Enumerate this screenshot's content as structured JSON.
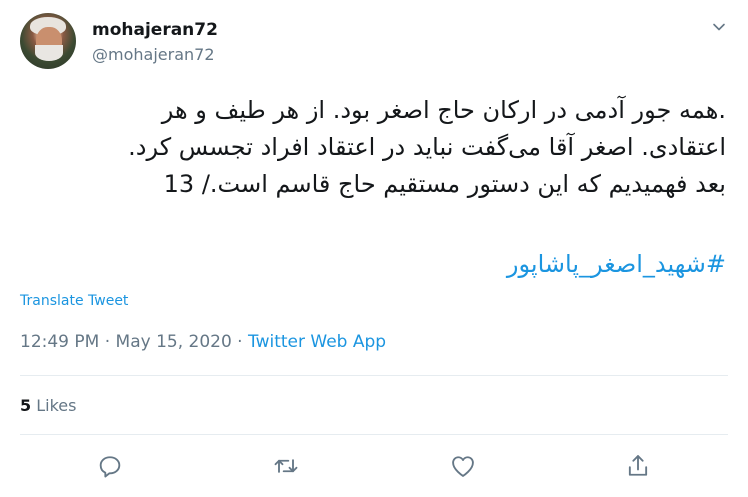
{
  "user": {
    "name": "mohajeran72",
    "handle": "@mohajeran72"
  },
  "tweet": {
    "lines": [
      ".همه جور آدمی در ارکان حاج اصغر بود. از هر طیف و هر",
      "اعتقادی. اصغر آقا می‌گفت نباید در اعتقاد افراد تجسس کرد.",
      "بعد فهمیدیم که این دستور مستقیم حاج قاسم است./ 13"
    ],
    "hashtag": "#شهید_اصغر_پاشاپور"
  },
  "translate_label": "Translate Tweet",
  "meta": {
    "time": "12:49 PM · May 15, 2020 · ",
    "source": "Twitter Web App"
  },
  "stats": {
    "likes_count": "5",
    "likes_label": "Likes"
  },
  "icons": {
    "menu": "chevron-down-icon",
    "reply": "reply-icon",
    "retweet": "retweet-icon",
    "like": "heart-icon",
    "share": "share-icon"
  },
  "colors": {
    "link": "#1b95e0",
    "secondary": "#657786",
    "text": "#14171a",
    "divider": "#e6ecf0"
  }
}
